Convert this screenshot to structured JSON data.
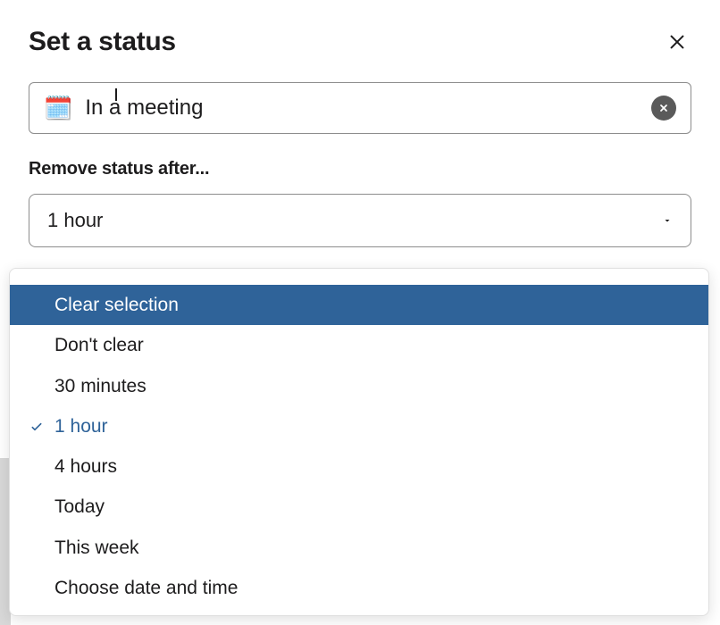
{
  "modal": {
    "title": "Set a status",
    "status_emoji": "🗓️",
    "status_text": "In a meeting",
    "remove_after_label": "Remove status after...",
    "selected_duration": "1 hour"
  },
  "dropdown": {
    "items": [
      {
        "label": "Clear selection",
        "highlighted": true,
        "selected": false
      },
      {
        "label": "Don't clear",
        "highlighted": false,
        "selected": false
      },
      {
        "label": "30 minutes",
        "highlighted": false,
        "selected": false
      },
      {
        "label": "1 hour",
        "highlighted": false,
        "selected": true
      },
      {
        "label": "4 hours",
        "highlighted": false,
        "selected": false
      },
      {
        "label": "Today",
        "highlighted": false,
        "selected": false
      },
      {
        "label": "This week",
        "highlighted": false,
        "selected": false
      },
      {
        "label": "Choose date and time",
        "highlighted": false,
        "selected": false
      }
    ]
  }
}
